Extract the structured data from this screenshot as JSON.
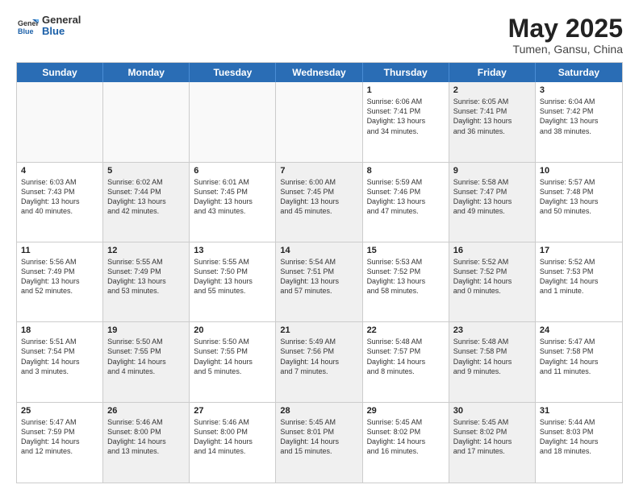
{
  "header": {
    "logo_general": "General",
    "logo_blue": "Blue",
    "month_year": "May 2025",
    "location": "Tumen, Gansu, China"
  },
  "weekdays": [
    "Sunday",
    "Monday",
    "Tuesday",
    "Wednesday",
    "Thursday",
    "Friday",
    "Saturday"
  ],
  "rows": [
    [
      {
        "day": "",
        "empty": true
      },
      {
        "day": "",
        "empty": true
      },
      {
        "day": "",
        "empty": true
      },
      {
        "day": "",
        "empty": true
      },
      {
        "day": "1",
        "line1": "Sunrise: 6:06 AM",
        "line2": "Sunset: 7:41 PM",
        "line3": "Daylight: 13 hours",
        "line4": "and 34 minutes."
      },
      {
        "day": "2",
        "line1": "Sunrise: 6:05 AM",
        "line2": "Sunset: 7:41 PM",
        "line3": "Daylight: 13 hours",
        "line4": "and 36 minutes.",
        "shaded": true
      },
      {
        "day": "3",
        "line1": "Sunrise: 6:04 AM",
        "line2": "Sunset: 7:42 PM",
        "line3": "Daylight: 13 hours",
        "line4": "and 38 minutes."
      }
    ],
    [
      {
        "day": "4",
        "line1": "Sunrise: 6:03 AM",
        "line2": "Sunset: 7:43 PM",
        "line3": "Daylight: 13 hours",
        "line4": "and 40 minutes."
      },
      {
        "day": "5",
        "line1": "Sunrise: 6:02 AM",
        "line2": "Sunset: 7:44 PM",
        "line3": "Daylight: 13 hours",
        "line4": "and 42 minutes.",
        "shaded": true
      },
      {
        "day": "6",
        "line1": "Sunrise: 6:01 AM",
        "line2": "Sunset: 7:45 PM",
        "line3": "Daylight: 13 hours",
        "line4": "and 43 minutes."
      },
      {
        "day": "7",
        "line1": "Sunrise: 6:00 AM",
        "line2": "Sunset: 7:45 PM",
        "line3": "Daylight: 13 hours",
        "line4": "and 45 minutes.",
        "shaded": true
      },
      {
        "day": "8",
        "line1": "Sunrise: 5:59 AM",
        "line2": "Sunset: 7:46 PM",
        "line3": "Daylight: 13 hours",
        "line4": "and 47 minutes."
      },
      {
        "day": "9",
        "line1": "Sunrise: 5:58 AM",
        "line2": "Sunset: 7:47 PM",
        "line3": "Daylight: 13 hours",
        "line4": "and 49 minutes.",
        "shaded": true
      },
      {
        "day": "10",
        "line1": "Sunrise: 5:57 AM",
        "line2": "Sunset: 7:48 PM",
        "line3": "Daylight: 13 hours",
        "line4": "and 50 minutes."
      }
    ],
    [
      {
        "day": "11",
        "line1": "Sunrise: 5:56 AM",
        "line2": "Sunset: 7:49 PM",
        "line3": "Daylight: 13 hours",
        "line4": "and 52 minutes."
      },
      {
        "day": "12",
        "line1": "Sunrise: 5:55 AM",
        "line2": "Sunset: 7:49 PM",
        "line3": "Daylight: 13 hours",
        "line4": "and 53 minutes.",
        "shaded": true
      },
      {
        "day": "13",
        "line1": "Sunrise: 5:55 AM",
        "line2": "Sunset: 7:50 PM",
        "line3": "Daylight: 13 hours",
        "line4": "and 55 minutes."
      },
      {
        "day": "14",
        "line1": "Sunrise: 5:54 AM",
        "line2": "Sunset: 7:51 PM",
        "line3": "Daylight: 13 hours",
        "line4": "and 57 minutes.",
        "shaded": true
      },
      {
        "day": "15",
        "line1": "Sunrise: 5:53 AM",
        "line2": "Sunset: 7:52 PM",
        "line3": "Daylight: 13 hours",
        "line4": "and 58 minutes."
      },
      {
        "day": "16",
        "line1": "Sunrise: 5:52 AM",
        "line2": "Sunset: 7:52 PM",
        "line3": "Daylight: 14 hours",
        "line4": "and 0 minutes.",
        "shaded": true
      },
      {
        "day": "17",
        "line1": "Sunrise: 5:52 AM",
        "line2": "Sunset: 7:53 PM",
        "line3": "Daylight: 14 hours",
        "line4": "and 1 minute."
      }
    ],
    [
      {
        "day": "18",
        "line1": "Sunrise: 5:51 AM",
        "line2": "Sunset: 7:54 PM",
        "line3": "Daylight: 14 hours",
        "line4": "and 3 minutes."
      },
      {
        "day": "19",
        "line1": "Sunrise: 5:50 AM",
        "line2": "Sunset: 7:55 PM",
        "line3": "Daylight: 14 hours",
        "line4": "and 4 minutes.",
        "shaded": true
      },
      {
        "day": "20",
        "line1": "Sunrise: 5:50 AM",
        "line2": "Sunset: 7:55 PM",
        "line3": "Daylight: 14 hours",
        "line4": "and 5 minutes."
      },
      {
        "day": "21",
        "line1": "Sunrise: 5:49 AM",
        "line2": "Sunset: 7:56 PM",
        "line3": "Daylight: 14 hours",
        "line4": "and 7 minutes.",
        "shaded": true
      },
      {
        "day": "22",
        "line1": "Sunrise: 5:48 AM",
        "line2": "Sunset: 7:57 PM",
        "line3": "Daylight: 14 hours",
        "line4": "and 8 minutes."
      },
      {
        "day": "23",
        "line1": "Sunrise: 5:48 AM",
        "line2": "Sunset: 7:58 PM",
        "line3": "Daylight: 14 hours",
        "line4": "and 9 minutes.",
        "shaded": true
      },
      {
        "day": "24",
        "line1": "Sunrise: 5:47 AM",
        "line2": "Sunset: 7:58 PM",
        "line3": "Daylight: 14 hours",
        "line4": "and 11 minutes."
      }
    ],
    [
      {
        "day": "25",
        "line1": "Sunrise: 5:47 AM",
        "line2": "Sunset: 7:59 PM",
        "line3": "Daylight: 14 hours",
        "line4": "and 12 minutes."
      },
      {
        "day": "26",
        "line1": "Sunrise: 5:46 AM",
        "line2": "Sunset: 8:00 PM",
        "line3": "Daylight: 14 hours",
        "line4": "and 13 minutes.",
        "shaded": true
      },
      {
        "day": "27",
        "line1": "Sunrise: 5:46 AM",
        "line2": "Sunset: 8:00 PM",
        "line3": "Daylight: 14 hours",
        "line4": "and 14 minutes."
      },
      {
        "day": "28",
        "line1": "Sunrise: 5:45 AM",
        "line2": "Sunset: 8:01 PM",
        "line3": "Daylight: 14 hours",
        "line4": "and 15 minutes.",
        "shaded": true
      },
      {
        "day": "29",
        "line1": "Sunrise: 5:45 AM",
        "line2": "Sunset: 8:02 PM",
        "line3": "Daylight: 14 hours",
        "line4": "and 16 minutes."
      },
      {
        "day": "30",
        "line1": "Sunrise: 5:45 AM",
        "line2": "Sunset: 8:02 PM",
        "line3": "Daylight: 14 hours",
        "line4": "and 17 minutes.",
        "shaded": true
      },
      {
        "day": "31",
        "line1": "Sunrise: 5:44 AM",
        "line2": "Sunset: 8:03 PM",
        "line3": "Daylight: 14 hours",
        "line4": "and 18 minutes."
      }
    ]
  ]
}
